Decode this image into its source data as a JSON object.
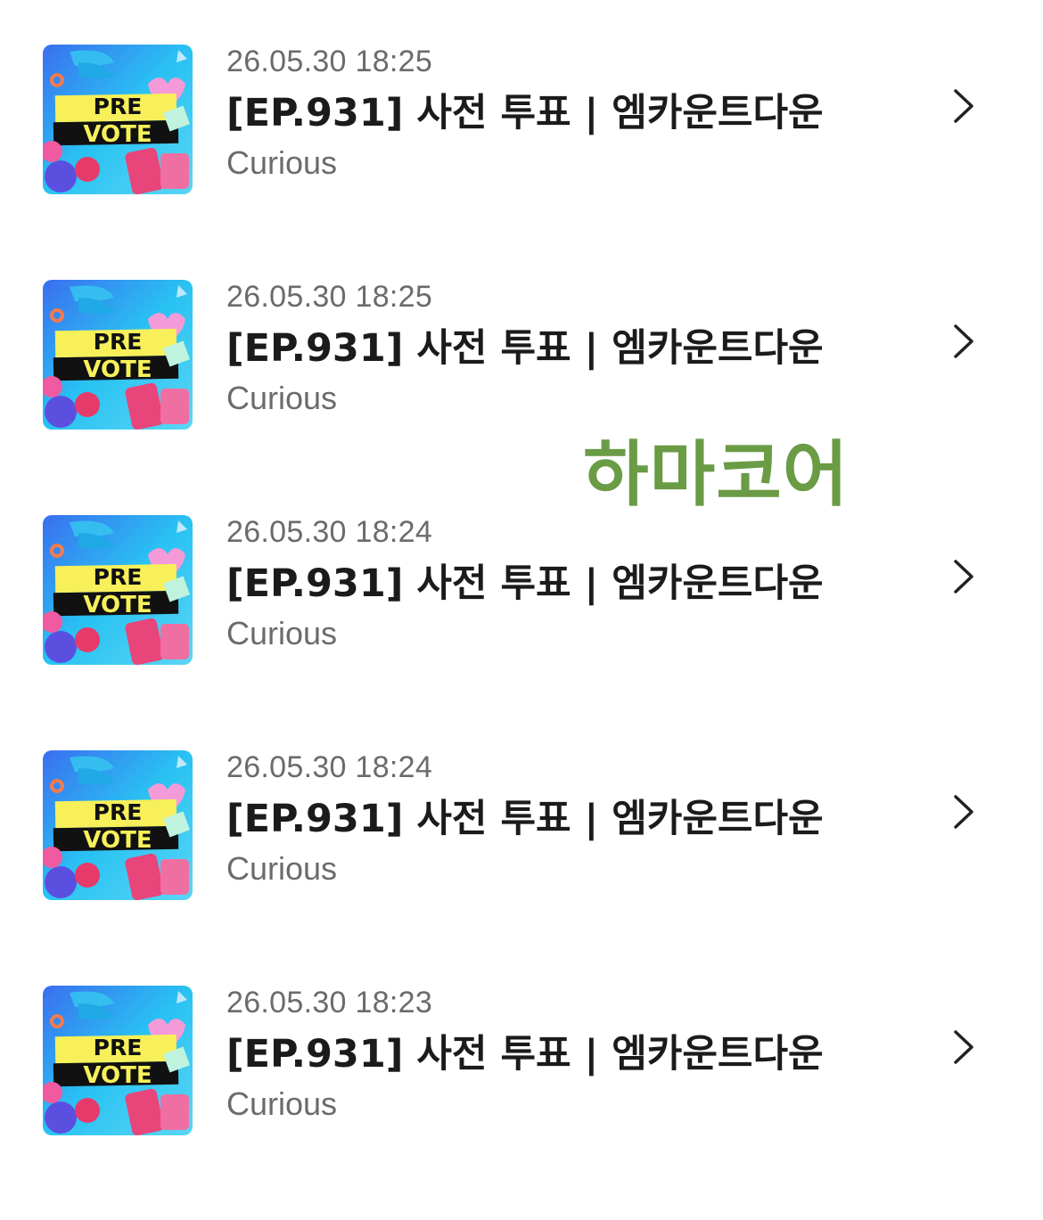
{
  "items": [
    {
      "date": "26.05.30 18:25",
      "title": "[EP.931] 사전 투표 | 엠카운트다운",
      "subtitle": "Curious",
      "thumb_top": "PRE",
      "thumb_bottom": "VOTE"
    },
    {
      "date": "26.05.30 18:25",
      "title": "[EP.931] 사전 투표 | 엠카운트다운",
      "subtitle": "Curious",
      "thumb_top": "PRE",
      "thumb_bottom": "VOTE"
    },
    {
      "date": "26.05.30 18:24",
      "title": "[EP.931] 사전 투표 | 엠카운트다운",
      "subtitle": "Curious",
      "thumb_top": "PRE",
      "thumb_bottom": "VOTE"
    },
    {
      "date": "26.05.30 18:24",
      "title": "[EP.931] 사전 투표 | 엠카운트다운",
      "subtitle": "Curious",
      "thumb_top": "PRE",
      "thumb_bottom": "VOTE"
    },
    {
      "date": "26.05.30 18:23",
      "title": "[EP.931] 사전 투표 | 엠카운트다운",
      "subtitle": "Curious",
      "thumb_top": "PRE",
      "thumb_bottom": "VOTE"
    }
  ],
  "watermark": "하마코어",
  "colors": {
    "watermark": "#6a9b45",
    "thumb_background": "#2fb8f0",
    "banner_yellow": "#f7f05a",
    "banner_black": "#111111"
  },
  "icons": {
    "chevron": "chevron-right-icon"
  }
}
